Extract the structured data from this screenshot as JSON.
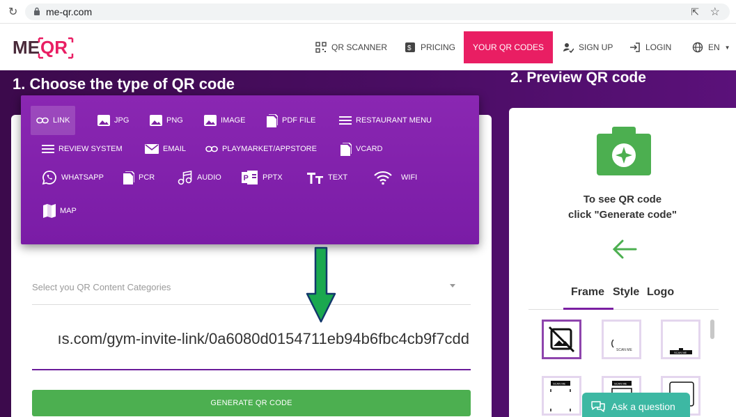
{
  "browser": {
    "url": "me-qr.com"
  },
  "header": {
    "logo": "MEQR",
    "nav": [
      {
        "label": "QR SCANNER",
        "icon": "qr-scanner-icon"
      },
      {
        "label": "PRICING",
        "icon": "pricing-icon"
      },
      {
        "label": "YOUR QR CODES",
        "icon": ""
      },
      {
        "label": "SIGN UP",
        "icon": "user-add-icon"
      },
      {
        "label": "LOGIN",
        "icon": "login-icon"
      },
      {
        "label": "EN",
        "icon": "globe-icon"
      }
    ],
    "accent_color": "#e91e63"
  },
  "left": {
    "heading": "1. Choose the type of QR code",
    "types": [
      {
        "label": "LINK",
        "icon": "link-icon",
        "active": true
      },
      {
        "label": "JPG",
        "icon": "image-icon"
      },
      {
        "label": "PNG",
        "icon": "image-icon"
      },
      {
        "label": "IMAGE",
        "icon": "image-icon"
      },
      {
        "label": "PDF FILE",
        "icon": "file-icon"
      },
      {
        "label": "RESTAURANT MENU",
        "icon": "menu-icon"
      },
      {
        "label": "REVIEW SYSTEM",
        "icon": "menu-icon"
      },
      {
        "label": "EMAIL",
        "icon": "mail-icon"
      },
      {
        "label": "PLAYMARKET/APPSTORE",
        "icon": "link-icon"
      },
      {
        "label": "VCARD",
        "icon": "file-icon"
      },
      {
        "label": "WHATSAPP",
        "icon": "whatsapp-icon"
      },
      {
        "label": "PCR",
        "icon": "file-icon"
      },
      {
        "label": "AUDIO",
        "icon": "music-icon"
      },
      {
        "label": "PPTX",
        "icon": "powerpoint-icon"
      },
      {
        "label": "TEXT",
        "icon": "text-icon"
      },
      {
        "label": "WIFI",
        "icon": "wifi-icon"
      },
      {
        "label": "MAP",
        "icon": "map-icon"
      }
    ],
    "category_placeholder": "Select you QR Content Categories",
    "url_value": "ıs.com/gym-invite-link/0a6080d0154711eb94b6fbc4cb9f7cdd",
    "generate_label": "GENERATE QR CODE",
    "panel_color": "#7b1fa2",
    "button_color": "#4caf50"
  },
  "right": {
    "heading": "2. Preview QR code",
    "preview_line1": "To see QR code",
    "preview_line2": "click \"Generate code\"",
    "tabs": [
      "Frame",
      "Style",
      "Logo"
    ],
    "frame_labels": [
      "SCAN ME",
      "SCAN ME",
      "SCAN ME",
      "SCAN ME"
    ],
    "ask_label": "Ask a question"
  }
}
